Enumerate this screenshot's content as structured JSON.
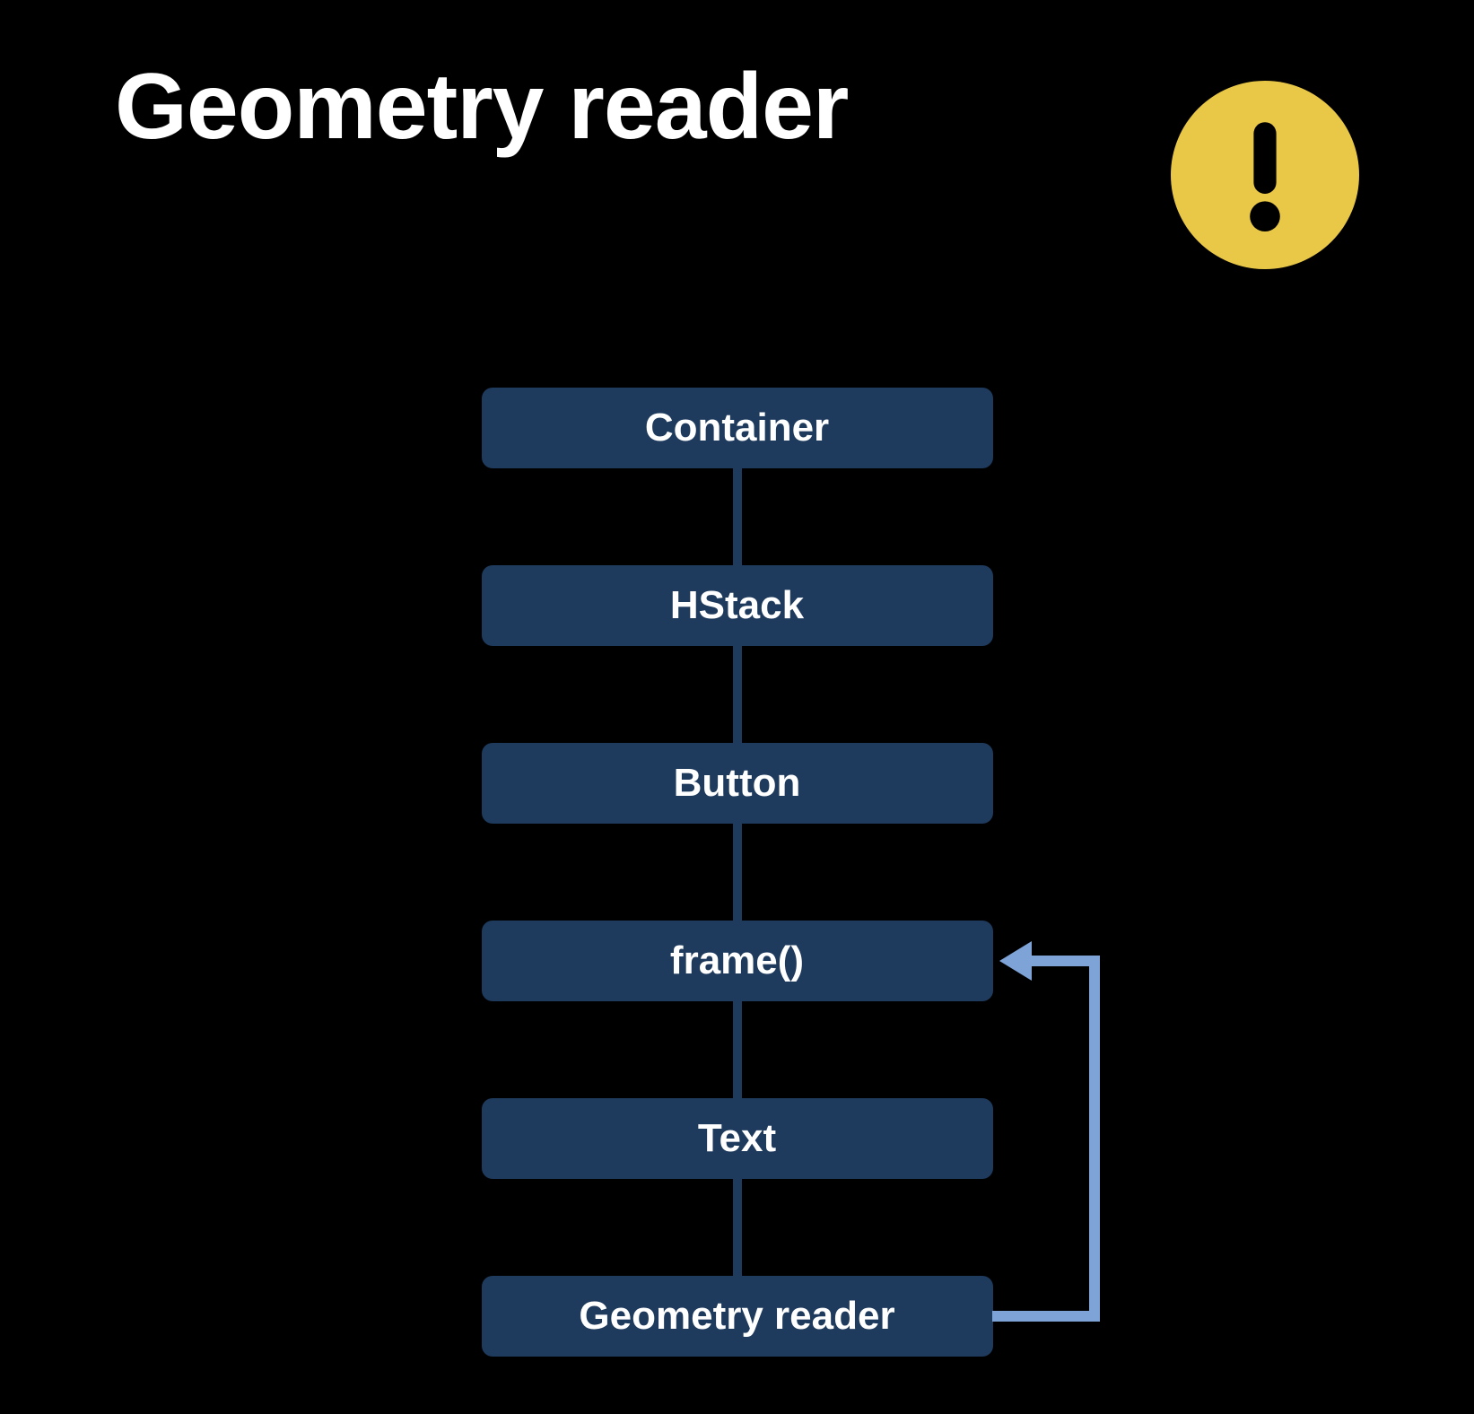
{
  "title": "Geometry reader",
  "icon": "warning-icon",
  "nodes": [
    {
      "label": "Container"
    },
    {
      "label": "HStack"
    },
    {
      "label": "Button"
    },
    {
      "label": "frame()"
    },
    {
      "label": "Text"
    },
    {
      "label": "Geometry reader"
    }
  ],
  "loop": {
    "from_index": 5,
    "to_index": 3
  },
  "colors": {
    "node_fill": "#1e3a5c",
    "badge_fill": "#eac847",
    "arrow": "#7ea3d6",
    "bg": "#000000"
  }
}
